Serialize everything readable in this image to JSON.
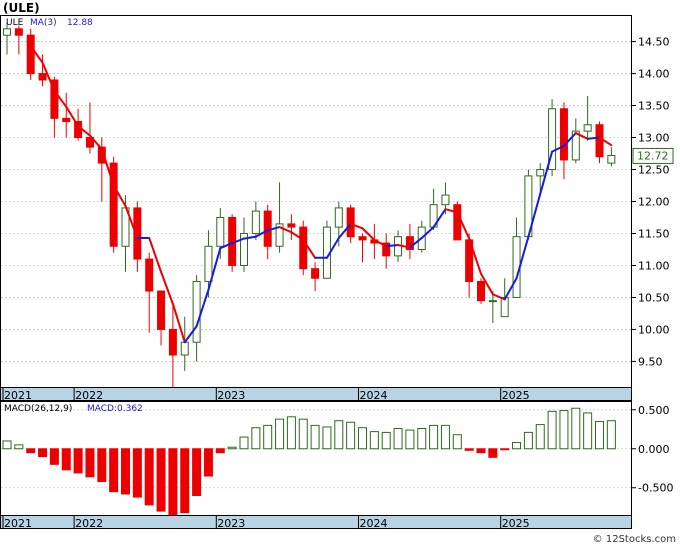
{
  "title": "(ULE)",
  "price_panel": {
    "legend_symbol": "ULE",
    "legend_ma": "MA(3)",
    "legend_ma_value": "12.88",
    "last_price": "12.72",
    "last_price_value": 12.72,
    "yticks": [
      "14.50",
      "14.00",
      "13.50",
      "13.00",
      "12.50",
      "12.00",
      "11.50",
      "11.00",
      "10.50",
      "10.00",
      "9.50"
    ],
    "ytick_values": [
      14.5,
      14.0,
      13.5,
      13.0,
      12.5,
      12.0,
      11.5,
      11.0,
      10.5,
      10.0,
      9.5
    ]
  },
  "macd_panel": {
    "legend_label": "MACD(26,12,9)",
    "legend_value": "MACD:0.362",
    "yticks": [
      "0.500",
      "0.000",
      "-0.500"
    ],
    "ytick_values": [
      0.5,
      0.0,
      -0.5
    ]
  },
  "x_axis": {
    "labels": [
      "2021",
      "2022",
      "2023",
      "2024",
      "2025"
    ],
    "label_positions": [
      0,
      6,
      18,
      30,
      42
    ]
  },
  "footer": {
    "credit": "© 12Stocks.com"
  },
  "colors": {
    "up": "#2e6b1e",
    "down": "#ee0000",
    "ma_up": "#1a1adb",
    "ma_down": "#ee0000",
    "axis_strip": "#b8d4e4",
    "grid": "#c8c8c8",
    "price_box": "#2e6b1e"
  },
  "chart_data": {
    "type": "candlestick",
    "interval": "monthly",
    "ma_period": 3,
    "ohlc": [
      [
        14.6,
        14.8,
        14.3,
        14.7
      ],
      [
        14.7,
        14.75,
        14.3,
        14.6
      ],
      [
        14.6,
        14.7,
        13.9,
        14.0
      ],
      [
        14.0,
        14.3,
        13.8,
        13.9
      ],
      [
        13.9,
        13.95,
        13.0,
        13.3
      ],
      [
        13.3,
        13.7,
        13.0,
        13.25
      ],
      [
        13.25,
        13.45,
        12.95,
        13.0
      ],
      [
        13.0,
        13.55,
        12.75,
        12.85
      ],
      [
        12.85,
        13.0,
        12.0,
        12.6
      ],
      [
        12.6,
        12.7,
        11.2,
        11.3
      ],
      [
        11.3,
        12.1,
        10.9,
        11.9
      ],
      [
        11.9,
        12.0,
        10.9,
        11.1
      ],
      [
        11.1,
        11.2,
        9.95,
        10.6
      ],
      [
        10.6,
        10.6,
        9.75,
        10.0
      ],
      [
        10.0,
        10.4,
        9.1,
        9.6
      ],
      [
        9.6,
        10.2,
        9.35,
        9.8
      ],
      [
        9.8,
        10.85,
        9.5,
        10.75
      ],
      [
        10.75,
        11.55,
        10.5,
        11.3
      ],
      [
        11.3,
        11.9,
        11.1,
        11.75
      ],
      [
        11.75,
        11.8,
        10.9,
        11.0
      ],
      [
        11.0,
        11.75,
        10.9,
        11.5
      ],
      [
        11.5,
        12.0,
        11.4,
        11.85
      ],
      [
        11.85,
        11.95,
        11.1,
        11.3
      ],
      [
        11.3,
        12.3,
        11.2,
        11.65
      ],
      [
        11.65,
        11.8,
        11.4,
        11.6
      ],
      [
        11.6,
        11.7,
        10.85,
        10.95
      ],
      [
        10.95,
        11.05,
        10.6,
        10.8
      ],
      [
        10.8,
        11.7,
        10.8,
        11.6
      ],
      [
        11.6,
        12.0,
        11.3,
        11.9
      ],
      [
        11.9,
        11.95,
        11.35,
        11.45
      ],
      [
        11.45,
        11.5,
        11.05,
        11.4
      ],
      [
        11.4,
        11.65,
        11.1,
        11.35
      ],
      [
        11.35,
        11.5,
        10.95,
        11.15
      ],
      [
        11.15,
        11.55,
        11.05,
        11.45
      ],
      [
        11.45,
        11.65,
        11.1,
        11.25
      ],
      [
        11.25,
        11.7,
        11.2,
        11.6
      ],
      [
        11.6,
        12.2,
        11.55,
        11.95
      ],
      [
        11.95,
        12.3,
        11.8,
        12.1
      ],
      [
        11.95,
        12.0,
        11.5,
        11.4
      ],
      [
        11.4,
        11.5,
        10.5,
        10.75
      ],
      [
        10.75,
        10.8,
        10.4,
        10.45
      ],
      [
        10.45,
        10.6,
        10.1,
        10.45
      ],
      [
        10.2,
        10.8,
        10.2,
        10.5
      ],
      [
        10.5,
        11.75,
        10.5,
        11.45
      ],
      [
        11.45,
        12.5,
        11.4,
        12.4
      ],
      [
        12.4,
        12.6,
        12.1,
        12.5
      ],
      [
        12.5,
        13.6,
        12.4,
        13.45
      ],
      [
        13.45,
        13.55,
        12.35,
        12.65
      ],
      [
        12.65,
        13.3,
        12.6,
        13.1
      ],
      [
        13.1,
        13.65,
        12.95,
        13.2
      ],
      [
        13.2,
        13.25,
        12.6,
        12.7
      ],
      [
        12.6,
        12.85,
        12.55,
        12.72
      ]
    ],
    "ma": [
      null,
      null,
      14.43,
      14.17,
      13.73,
      13.48,
      13.18,
      13.03,
      12.82,
      12.25,
      11.93,
      11.43,
      11.43,
      10.9,
      10.4,
      9.8,
      10.05,
      10.62,
      11.27,
      11.35,
      11.42,
      11.45,
      11.55,
      11.6,
      11.52,
      11.4,
      11.12,
      11.12,
      11.43,
      11.65,
      11.58,
      11.4,
      11.3,
      11.32,
      11.28,
      11.43,
      11.6,
      11.88,
      11.83,
      11.42,
      10.87,
      10.55,
      10.47,
      10.8,
      11.45,
      12.12,
      12.78,
      12.87,
      13.07,
      12.98,
      13.0,
      12.88
    ],
    "macd": [
      0.1,
      0.05,
      -0.05,
      -0.1,
      -0.2,
      -0.27,
      -0.31,
      -0.36,
      -0.42,
      -0.55,
      -0.58,
      -0.62,
      -0.72,
      -0.8,
      -0.85,
      -0.82,
      -0.6,
      -0.35,
      -0.05,
      0.02,
      0.15,
      0.27,
      0.3,
      0.38,
      0.41,
      0.38,
      0.3,
      0.28,
      0.36,
      0.34,
      0.27,
      0.22,
      0.21,
      0.26,
      0.24,
      0.26,
      0.3,
      0.3,
      0.18,
      -0.02,
      -0.05,
      -0.11,
      -0.01,
      0.08,
      0.21,
      0.31,
      0.48,
      0.49,
      0.52,
      0.46,
      0.35,
      0.36
    ],
    "ylim_price": [
      9.1,
      14.9
    ],
    "ylim_macd": [
      -0.85,
      0.6
    ]
  }
}
